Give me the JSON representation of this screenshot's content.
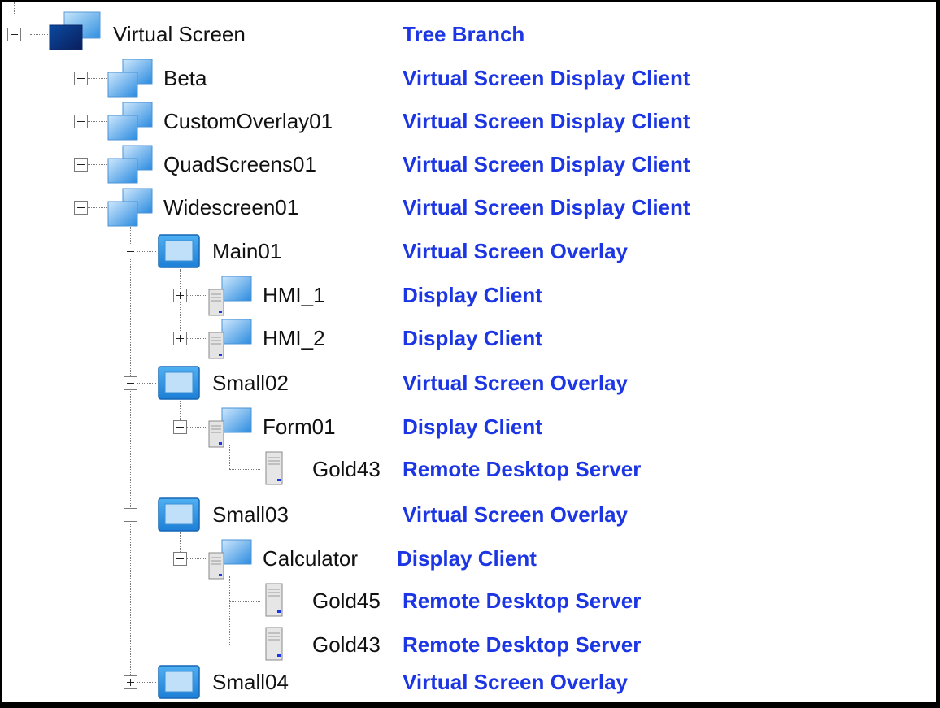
{
  "tree": {
    "nodes": [
      {
        "id": "virtual-screen",
        "label": "Virtual Screen",
        "type": "Tree Branch",
        "icon": "virtual-screen-icon",
        "expanded": true
      },
      {
        "id": "beta",
        "label": "Beta",
        "type": "Virtual Screen Display Client",
        "icon": "display-client-group-icon",
        "expanded": false
      },
      {
        "id": "customoverlay01",
        "label": "CustomOverlay01",
        "type": "Virtual Screen Display Client",
        "icon": "display-client-group-icon",
        "expanded": false
      },
      {
        "id": "quadscreens01",
        "label": "QuadScreens01",
        "type": "Virtual Screen Display Client",
        "icon": "display-client-group-icon",
        "expanded": false
      },
      {
        "id": "widescreen01",
        "label": "Widescreen01",
        "type": "Virtual Screen Display Client",
        "icon": "display-client-group-icon",
        "expanded": true
      },
      {
        "id": "main01",
        "label": "Main01",
        "type": "Virtual Screen Overlay",
        "icon": "overlay-monitor-icon",
        "expanded": true
      },
      {
        "id": "hmi-1",
        "label": "HMI_1",
        "type": "Display Client",
        "icon": "display-client-computer-icon",
        "expanded": false
      },
      {
        "id": "hmi-2",
        "label": "HMI_2",
        "type": "Display Client",
        "icon": "display-client-computer-icon",
        "expanded": false
      },
      {
        "id": "small02",
        "label": "Small02",
        "type": "Virtual Screen Overlay",
        "icon": "overlay-monitor-icon",
        "expanded": true
      },
      {
        "id": "form01",
        "label": "Form01",
        "type": "Display Client",
        "icon": "display-client-computer-icon",
        "expanded": true
      },
      {
        "id": "gold43-a",
        "label": "Gold43",
        "type": "Remote Desktop Server",
        "icon": "server-tower-icon"
      },
      {
        "id": "small03",
        "label": "Small03",
        "type": "Virtual Screen Overlay",
        "icon": "overlay-monitor-icon",
        "expanded": true
      },
      {
        "id": "calculator",
        "label": "Calculator",
        "type": "Display Client",
        "icon": "display-client-computer-icon",
        "expanded": true
      },
      {
        "id": "gold45",
        "label": "Gold45",
        "type": "Remote Desktop Server",
        "icon": "server-tower-icon"
      },
      {
        "id": "gold43-b",
        "label": "Gold43",
        "type": "Remote Desktop Server",
        "icon": "server-tower-icon"
      },
      {
        "id": "small04",
        "label": "Small04",
        "type": "Virtual Screen Overlay",
        "icon": "overlay-monitor-icon",
        "expanded": false
      }
    ]
  },
  "colors": {
    "annotation": "#1c36e4",
    "text": "#111111",
    "tree_lines": "#7a7a7a"
  }
}
